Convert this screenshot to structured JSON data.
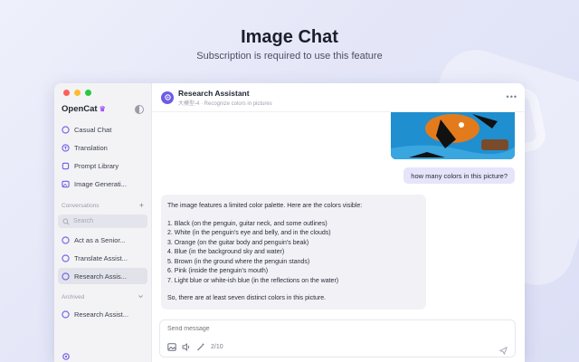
{
  "hero": {
    "title": "Image Chat",
    "subtitle": "Subscription is required to use this feature"
  },
  "sidebar": {
    "app_name": "OpenCat",
    "nav": [
      {
        "label": "Casual Chat",
        "icon": "chat-bubble-icon"
      },
      {
        "label": "Translation",
        "icon": "translate-icon"
      },
      {
        "label": "Prompt Library",
        "icon": "library-icon"
      },
      {
        "label": "Image Generati...",
        "icon": "image-icon"
      }
    ],
    "conversations_label": "Conversations",
    "search_placeholder": "Search",
    "conversations": [
      {
        "label": "Act as a Senior...",
        "active": false
      },
      {
        "label": "Translate Assist...",
        "active": false
      },
      {
        "label": "Research Assis...",
        "active": true
      }
    ],
    "archived_label": "Archived",
    "archived": [
      {
        "label": "Research Assist..."
      }
    ]
  },
  "chat": {
    "title": "Research Assistant",
    "subtitle": "大模型-4 · Recognize colors in pictures",
    "user_message": "how many colors in this picture?",
    "bot_lines": [
      "The image features a limited color palette. Here are the colors visible:",
      "",
      "1. Black (on the penguin, guitar neck, and some outlines)",
      "2. White (in the penguin's eye and belly, and in the clouds)",
      "3. Orange (on the guitar body and penguin's beak)",
      "4. Blue (in the background sky and water)",
      "5. Brown (in the ground where the penguin stands)",
      "6. Pink (inside the penguin's mouth)",
      "7. Light blue or white-ish blue (in the reflections on the water)",
      "",
      "So, there are at least seven distinct colors in this picture."
    ],
    "composer_placeholder": "Send message",
    "counter": "2/10"
  },
  "colors": {
    "accent": "#6c5ce7",
    "user_bubble": "#e6e4fb",
    "bot_bubble": "#f2f2f6",
    "image_bg": "#1f8fd0"
  }
}
